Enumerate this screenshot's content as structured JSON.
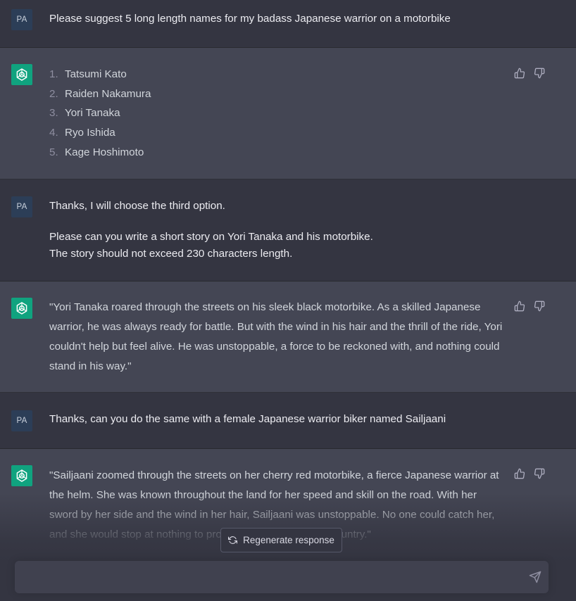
{
  "messages": {
    "m1": {
      "avatar": "PA",
      "text": "Please suggest 5 long length names for my badass Japanese warrior on a motorbike"
    },
    "m2": {
      "items": [
        {
          "num": "1.",
          "name": "Tatsumi Kato"
        },
        {
          "num": "2.",
          "name": "Raiden Nakamura"
        },
        {
          "num": "3.",
          "name": "Yori Tanaka"
        },
        {
          "num": "4.",
          "name": "Ryo Ishida"
        },
        {
          "num": "5.",
          "name": "Kage Hoshimoto"
        }
      ]
    },
    "m3": {
      "avatar": "PA",
      "p1": "Thanks, I will choose the third option.",
      "p2_line1": "Please can you write a short story on Yori Tanaka and his motorbike.",
      "p2_line2": "The story should not exceed 230 characters length."
    },
    "m4": {
      "text": "\"Yori Tanaka roared through the streets on his sleek black motorbike. As a skilled Japanese warrior, he was always ready for battle. But with the wind in his hair and the thrill of the ride, Yori couldn't help but feel alive. He was unstoppable, a force to be reckoned with, and nothing could stand in his way.\""
    },
    "m5": {
      "avatar": "PA",
      "text": "Thanks, can you do the same with a female Japanese warrior biker named Sailjaani"
    },
    "m6": {
      "text": "\"Sailjaani zoomed through the streets on her cherry red motorbike, a fierce Japanese warrior at the helm. She was known throughout the land for her speed and skill on the road. With her sword by her side and the wind in her hair, Sailjaani was unstoppable. No one could catch her, and she would stop at nothing to protect her honor and her country.\""
    }
  },
  "regenerate": {
    "label": "Regenerate response",
    "icon": "refresh-icon"
  },
  "composer": {
    "value": "",
    "placeholder": "",
    "send_icon": "send-icon"
  },
  "icons": {
    "bot_avatar": "openai-logo-icon",
    "like": "thumbs-up-icon",
    "dislike": "thumbs-down-icon"
  },
  "colors": {
    "bot_avatar_bg": "#10a37f",
    "user_avatar_bg": "#2c3e57",
    "bot_row_bg": "#444654",
    "user_row_bg": "#343541"
  }
}
